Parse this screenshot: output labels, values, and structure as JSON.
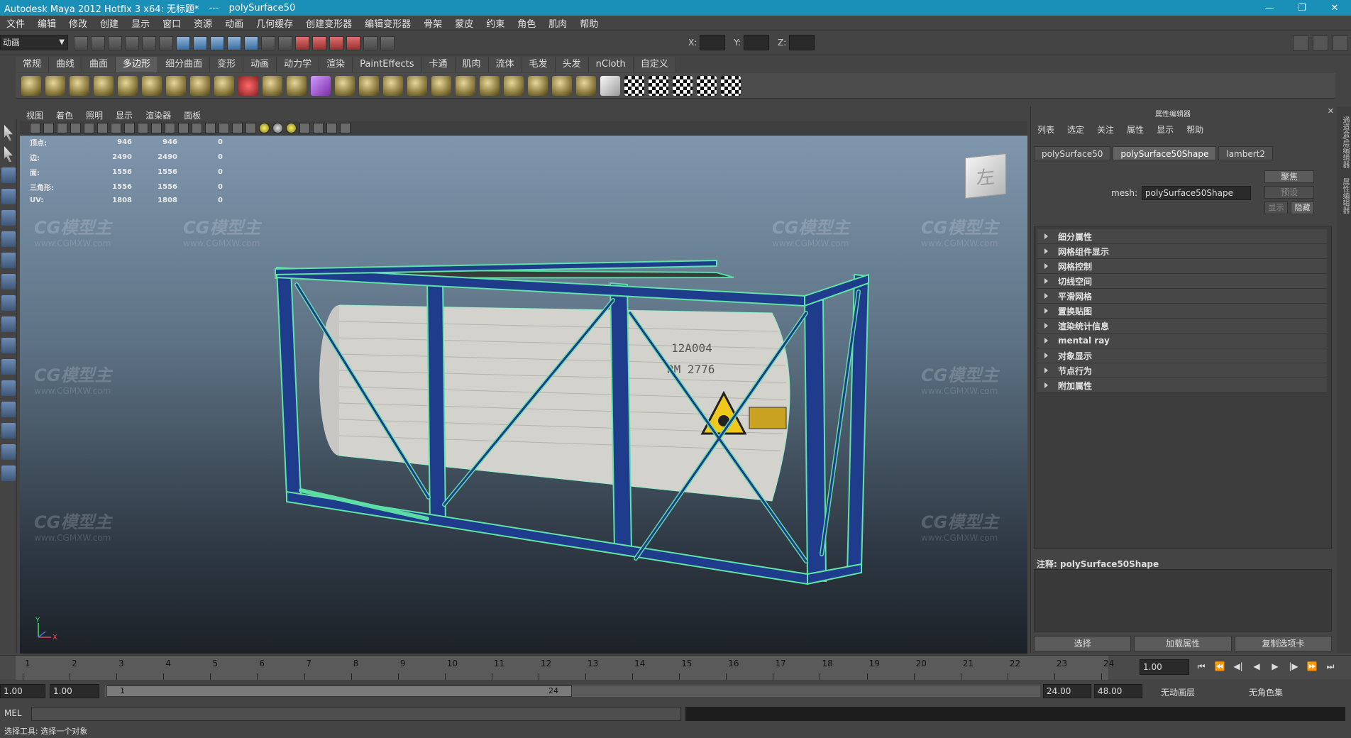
{
  "titlebar": {
    "app_title": "Autodesk Maya 2012 Hotfix 3 x64: 无标题*",
    "separator": "---",
    "object": "polySurface50",
    "buttons": [
      "—",
      "❐",
      "✕"
    ]
  },
  "menubar": [
    "文件",
    "编辑",
    "修改",
    "创建",
    "显示",
    "窗口",
    "资源",
    "动画",
    "几何缓存",
    "创建变形器",
    "编辑变形器",
    "骨架",
    "蒙皮",
    "约束",
    "角色",
    "肌肉",
    "帮助"
  ],
  "statusline": {
    "mode": "动画",
    "x_label": "X:",
    "y_label": "Y:",
    "z_label": "Z:"
  },
  "shelf": {
    "tabs": [
      "常规",
      "曲线",
      "曲面",
      "多边形",
      "细分曲面",
      "变形",
      "动画",
      "动力学",
      "渲染",
      "PaintEffects",
      "卡通",
      "肌肉",
      "流体",
      "毛发",
      "头发",
      "nCloth",
      "自定义"
    ],
    "active_tab": "多边形"
  },
  "panel": {
    "menu": [
      "视图",
      "着色",
      "照明",
      "显示",
      "渲染器",
      "面板"
    ]
  },
  "hud": {
    "rows": [
      {
        "label": "顶点:",
        "a": "946",
        "b": "946",
        "c": "0"
      },
      {
        "label": "边:",
        "a": "2490",
        "b": "2490",
        "c": "0"
      },
      {
        "label": "面:",
        "a": "1556",
        "b": "1556",
        "c": "0"
      },
      {
        "label": "三角形:",
        "a": "1556",
        "b": "1556",
        "c": "0"
      },
      {
        "label": "UV:",
        "a": "1808",
        "b": "1808",
        "c": "0"
      }
    ]
  },
  "viewcube": {
    "label": "左"
  },
  "axis": {
    "y": "Y",
    "x": "X"
  },
  "watermarks": {
    "text": "CG模型主",
    "url": "www.CGMXW.com"
  },
  "attribute_editor": {
    "title": "属性编辑器",
    "menu": [
      "列表",
      "选定",
      "关注",
      "属性",
      "显示",
      "帮助"
    ],
    "tabs": [
      "polySurface50",
      "polySurface50Shape",
      "lambert2"
    ],
    "active_tab": "polySurface50Shape",
    "mesh_label": "mesh:",
    "mesh_value": "polySurface50Shape",
    "focus_button": "聚焦",
    "preset_button": "预设",
    "show_button": "显示",
    "hide_button": "隐藏",
    "sections": [
      "细分属性",
      "网格组件显示",
      "网格控制",
      "切线空间",
      "平滑网格",
      "置换贴图",
      "渲染统计信息",
      "mental ray",
      "对象显示",
      "节点行为",
      "附加属性"
    ],
    "notes_label": "注释:",
    "notes_target": "polySurface50Shape",
    "bottom_buttons": [
      "选择",
      "加载属性",
      "复制选项卡"
    ]
  },
  "side_strip": [
    "通道盒/层编辑器",
    "属性编辑器"
  ],
  "timeline": {
    "ticks": [
      "1",
      "2",
      "3",
      "4",
      "5",
      "6",
      "7",
      "8",
      "9",
      "10",
      "11",
      "12",
      "13",
      "14",
      "15",
      "16",
      "17",
      "18",
      "19",
      "20",
      "21",
      "22",
      "23",
      "24"
    ],
    "current_frame": "1.00",
    "playback": [
      "⏮",
      "⏪",
      "◀|",
      "◀",
      "▶",
      "|▶",
      "⏩",
      "⏭"
    ]
  },
  "range": {
    "start": "1.00",
    "playback_start": "1.00",
    "handle_start": "1",
    "handle_end": "24",
    "playback_end": "24.00",
    "end": "48.00",
    "anim_layer": "无动画层",
    "char_set": "无角色集"
  },
  "cmdline": {
    "label": "MEL"
  },
  "helpline": {
    "text": "选择工具: 选择一个对象"
  }
}
